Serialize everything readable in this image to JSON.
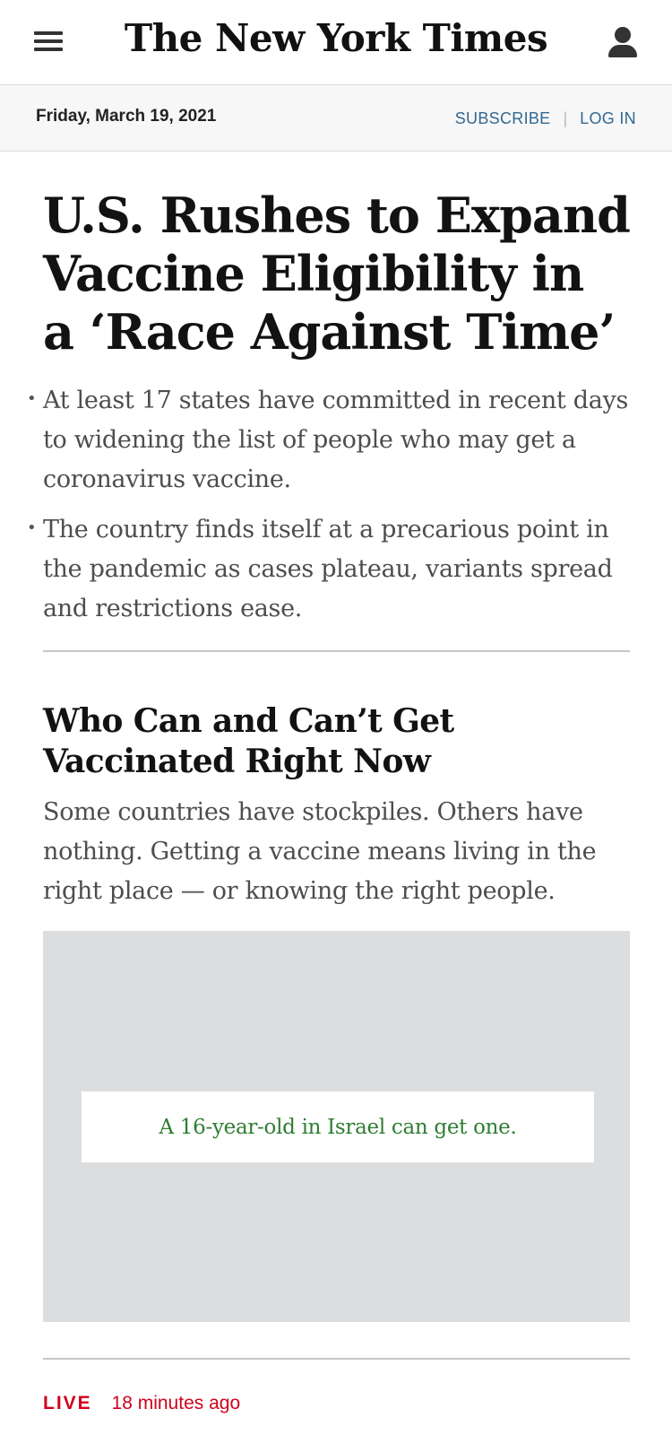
{
  "header": {
    "logo": "The New York Times",
    "menu_icon": "hamburger-menu-icon",
    "account_icon": "user-account-icon"
  },
  "datebar": {
    "date": "Friday, March 19, 2021",
    "subscribe": "SUBSCRIBE",
    "separator": "|",
    "login": "LOG IN"
  },
  "lead_story": {
    "headline": "U.S. Rushes to Expand Vaccine Eligibility in a ‘Race Against Time’",
    "bullets": [
      "At least 17 states have committed in recent days to widening the list of people who may get a coronavirus vaccine.",
      "The country finds itself at a precarious point in the pandemic as cases plateau, variants spread and restrictions ease."
    ]
  },
  "second_story": {
    "title": "Who Can and Can’t Get Vaccinated Right Now",
    "summary": "Some countries have stockpiles. Others have nothing. Getting a vaccine means living in the right place — or knowing the right people.",
    "media_caption": "A 16-year-old in Israel can get one."
  },
  "live": {
    "label": "LIVE",
    "timestamp": "18 minutes ago"
  },
  "colors": {
    "link_blue": "#326891",
    "live_red": "#d0021b",
    "caption_green": "#2e7d32"
  }
}
